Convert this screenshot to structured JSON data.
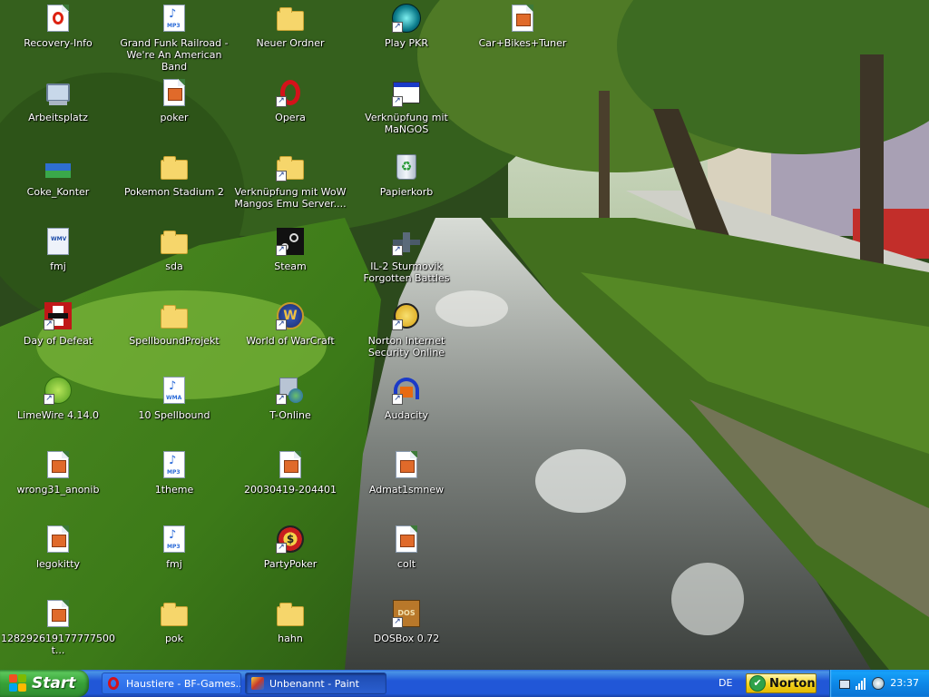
{
  "desktop": {
    "icons": [
      {
        "label": "Recovery-Info",
        "icon": "opera-doc-icon"
      },
      {
        "label": "Arbeitsplatz",
        "icon": "my-computer-icon"
      },
      {
        "label": "Coke_Konter",
        "icon": "winrar-archive-icon"
      },
      {
        "label": "fmj",
        "icon": "wmv-file-icon"
      },
      {
        "label": "Day of Defeat",
        "icon": "day-of-defeat-icon"
      },
      {
        "label": "LimeWire 4.14.0",
        "icon": "limewire-icon"
      },
      {
        "label": "wrong31_anonib",
        "icon": "image-file-icon"
      },
      {
        "label": "legokitty",
        "icon": "image-file-icon"
      },
      {
        "label": "128292619177777500t...",
        "icon": "image-file-icon"
      },
      {
        "label": "Grand Funk Railroad - We're An American Band",
        "icon": "mp3-file-icon"
      },
      {
        "label": "poker",
        "icon": "image-file-icon"
      },
      {
        "label": "Pokemon Stadium 2",
        "icon": "folder-icon"
      },
      {
        "label": "sda",
        "icon": "folder-icon"
      },
      {
        "label": "SpellboundProjekt",
        "icon": "folder-icon"
      },
      {
        "label": "10 Spellbound",
        "icon": "wma-file-icon"
      },
      {
        "label": "1theme",
        "icon": "mp3-file-icon"
      },
      {
        "label": "fmj",
        "icon": "mp3-file-icon"
      },
      {
        "label": "pok",
        "icon": "folder-icon"
      },
      {
        "label": "Neuer Ordner",
        "icon": "folder-icon"
      },
      {
        "label": "Opera",
        "icon": "opera-icon"
      },
      {
        "label": "Verknüpfung mit WoW Mangos Emu Server....",
        "icon": "folder-icon"
      },
      {
        "label": "Steam",
        "icon": "steam-icon"
      },
      {
        "label": "World of WarCraft",
        "icon": "world-of-warcraft-icon"
      },
      {
        "label": "T-Online",
        "icon": "t-online-icon"
      },
      {
        "label": "20030419-204401",
        "icon": "image-file-icon"
      },
      {
        "label": "PartyPoker",
        "icon": "partypoker-icon"
      },
      {
        "label": "hahn",
        "icon": "folder-icon"
      },
      {
        "label": "Play PKR",
        "icon": "pkr-icon"
      },
      {
        "label": "Verknüpfung mit MaNGOS",
        "icon": "application-window-icon"
      },
      {
        "label": "Papierkorb",
        "icon": "recycle-bin-icon"
      },
      {
        "label": "IL-2 Sturmovik Forgotten Battles",
        "icon": "il2-sturmovik-icon"
      },
      {
        "label": "Norton Internet Security Online",
        "icon": "norton-globe-icon"
      },
      {
        "label": "Audacity",
        "icon": "audacity-icon"
      },
      {
        "label": "Admat1smnew",
        "icon": "image-file-icon"
      },
      {
        "label": "colt",
        "icon": "image-file-icon"
      },
      {
        "label": "DOSBox 0.72",
        "icon": "dosbox-icon"
      },
      {
        "label": "Car+Bikes+Tuner",
        "icon": "image-file-icon"
      }
    ]
  },
  "taskbar": {
    "start_label": "Start",
    "tasks": [
      {
        "label": "Haustiere - BF-Games....",
        "icon": "opera-icon"
      },
      {
        "label": "Unbenannt - Paint",
        "icon": "paint-icon"
      }
    ],
    "language": "DE",
    "norton_label": "Norton",
    "clock": "23:37"
  },
  "colors": {
    "taskbar_blue": "#2157d7",
    "start_green": "#37a137",
    "tray_blue": "#0d88e8"
  }
}
